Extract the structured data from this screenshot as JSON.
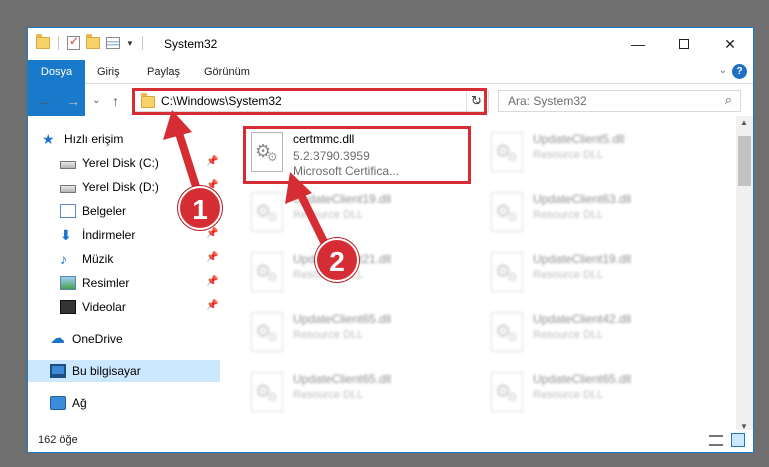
{
  "window": {
    "title": "System32",
    "controls": {
      "minimize": "—",
      "maximize": "",
      "close": "✕"
    }
  },
  "ribbon": {
    "tabs": [
      "Dosya",
      "Giriş",
      "Paylaş",
      "Görünüm"
    ],
    "expand": "⌄",
    "help": "?"
  },
  "nav": {
    "back": "←",
    "forward": "→",
    "recent": "⌄",
    "up": "↑",
    "address": "C:\\Windows\\System32",
    "address_dropdown": "⌄",
    "refresh": "↻",
    "search_placeholder": "Ara: System32",
    "search_icon": "⌕"
  },
  "sidebar": {
    "items": [
      {
        "label": "Hızlı erişim",
        "icon": "star-icon",
        "pinned": false
      },
      {
        "label": "Yerel Disk (C:)",
        "icon": "disk-icon",
        "pinned": true
      },
      {
        "label": "Yerel Disk (D:)",
        "icon": "disk-icon",
        "pinned": true
      },
      {
        "label": "Belgeler",
        "icon": "documents-icon",
        "pinned": true
      },
      {
        "label": "İndirmeler",
        "icon": "download-icon",
        "pinned": true
      },
      {
        "label": "Müzik",
        "icon": "music-icon",
        "pinned": true
      },
      {
        "label": "Resimler",
        "icon": "pictures-icon",
        "pinned": true
      },
      {
        "label": "Videolar",
        "icon": "videos-icon",
        "pinned": true
      },
      {
        "label": "OneDrive",
        "icon": "cloud-icon",
        "pinned": false
      },
      {
        "label": "Bu bilgisayar",
        "icon": "computer-icon",
        "pinned": false,
        "selected": true
      },
      {
        "label": "Ağ",
        "icon": "network-icon",
        "pinned": false
      }
    ],
    "pin_glyph": "📌"
  },
  "files": {
    "left": [
      {
        "name": "certmmc.dll",
        "line1": "5.2.3790.3959",
        "line2": "Microsoft Certifica..."
      },
      {
        "name": "UpdateClient19.dll",
        "line1": "Resource DLL"
      },
      {
        "name": "UpdateClient21.dll",
        "line1": "Resource DLL"
      },
      {
        "name": "UpdateClient65.dll",
        "line1": "Resource DLL"
      },
      {
        "name": "UpdateClient65.dll",
        "line1": "Resource DLL"
      }
    ],
    "right": [
      {
        "name": "UpdateClient5.dll",
        "line1": "Resource DLL"
      },
      {
        "name": "UpdateClient63.dll",
        "line1": "Resource DLL"
      },
      {
        "name": "UpdateClient19.dll",
        "line1": "Resource DLL"
      },
      {
        "name": "UpdateClient42.dll",
        "line1": "Resource DLL"
      },
      {
        "name": "UpdateClient65.dll",
        "line1": "Resource DLL"
      }
    ]
  },
  "status": {
    "count": "162 öğe"
  },
  "callouts": {
    "one": "1",
    "two": "2",
    "color": "#d62d35"
  }
}
